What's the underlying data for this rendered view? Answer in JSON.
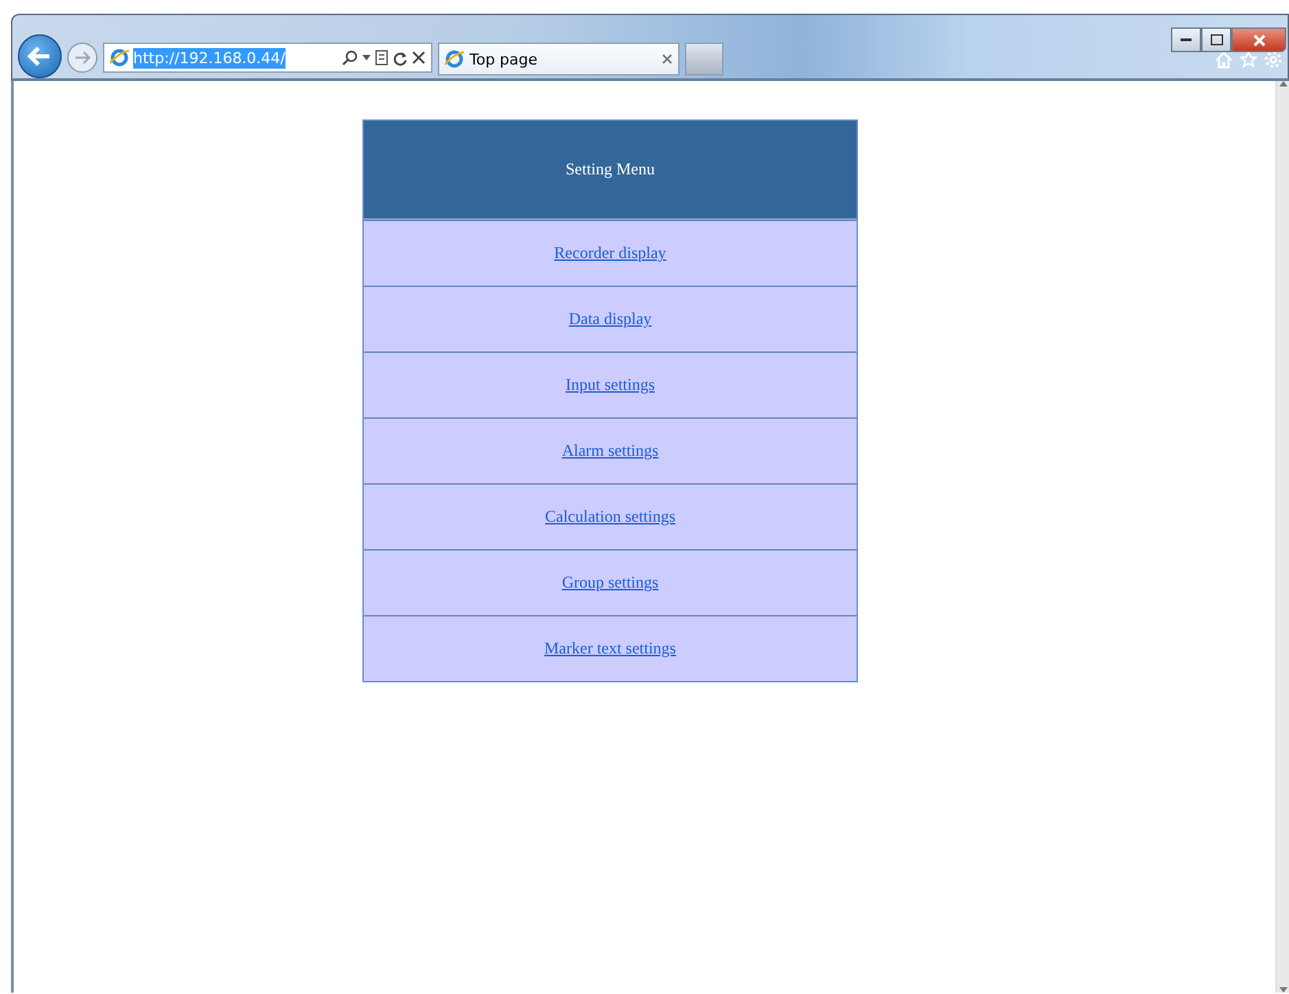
{
  "browser": {
    "address": "http://192.168.0.44/",
    "tab_title": "Top page"
  },
  "menu": {
    "title": "Setting Menu",
    "items": [
      {
        "label": "Recorder display"
      },
      {
        "label": "Data display"
      },
      {
        "label": "Input settings"
      },
      {
        "label": "Alarm settings"
      },
      {
        "label": "Calculation settings"
      },
      {
        "label": "Group settings"
      },
      {
        "label": "Marker text settings"
      }
    ]
  }
}
